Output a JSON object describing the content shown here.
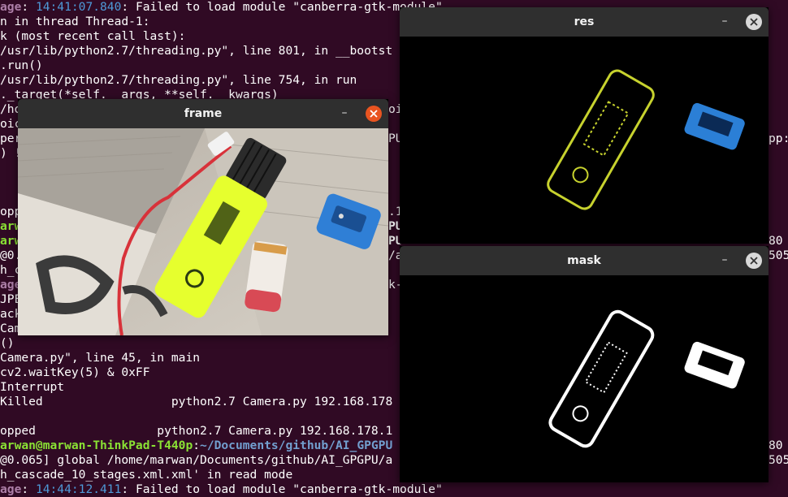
{
  "terminal": {
    "lines": [
      {
        "pre": "",
        "age": "age",
        "sep": ": ",
        "time": "14:41:07.840",
        "text": ": Failed to load module \"canberra-gtk-module\""
      },
      {
        "text": "n in thread Thread-1:"
      },
      {
        "text": "k (most recent call last):"
      },
      {
        "text": "/usr/lib/python2.7/threading.py\", line 801, in __bootst"
      },
      {
        "text": ".run()"
      },
      {
        "text": "/usr/lib/python2.7/threading.py\", line 754, in run"
      },
      {
        "text": "._target(*self.__args, **self.__kwargs)"
      },
      {
        "text": "/ho"
      },
      {
        "text": "oic"
      },
      {
        "text": "per"
      },
      {
        "text": ") !"
      },
      {
        "text": ""
      },
      {
        "text": ""
      },
      {
        "text": "opp"
      },
      {
        "text": "arw"
      },
      {
        "text": "arw"
      },
      {
        "text": "@0."
      },
      {
        "text": "h_c"
      },
      {
        "text": "age"
      },
      {
        "text": "JPE"
      },
      {
        "text": "ack"
      },
      {
        "text": "Cam"
      },
      {
        "text": "()"
      },
      {
        "text": "Camera.py\", line 45, in main"
      },
      {
        "text": "cv2.waitKey(5) & 0xFF"
      },
      {
        "text": "Interrupt"
      },
      {
        "text": "Killed                  python2.7 Camera.py 192.168.178"
      },
      {
        "text": ""
      },
      {
        "text": "opped                 python2.7 Camera.py 192.168.178.1"
      },
      {
        "user": "arwan@marwan-ThinkPad-T440p",
        "colon": ":",
        "path": "~/Documents/github/AI_GPGPU"
      },
      {
        "text": "@0.065] global /home/marwan/Documents/github/AI_GPGPU/a"
      },
      {
        "text": "h_cascade_10_stages.xml.xml' in read mode"
      },
      {
        "age": "age",
        "time": "14:44:12.411",
        "text": ": Failed to load module \"canberra-gtk-module\""
      }
    ],
    "right_fragments": [
      "oi",
      "PU",
      "pp:",
      ".1",
      "PU",
      "PU",
      "80",
      "/a",
      "505",
      "k-",
      "80",
      "505"
    ]
  },
  "windows": {
    "frame": {
      "title": "frame",
      "minimize": "–"
    },
    "res": {
      "title": "res",
      "minimize": "–"
    },
    "mask": {
      "title": "mask",
      "minimize": "–"
    }
  },
  "photo": {
    "objects": [
      "highlighter-marker",
      "usb-cable",
      "pencil-sharpener",
      "battery",
      "newspaper"
    ],
    "marker_color": "#e6ff2e",
    "sharpener_color": "#2f7fd6"
  }
}
